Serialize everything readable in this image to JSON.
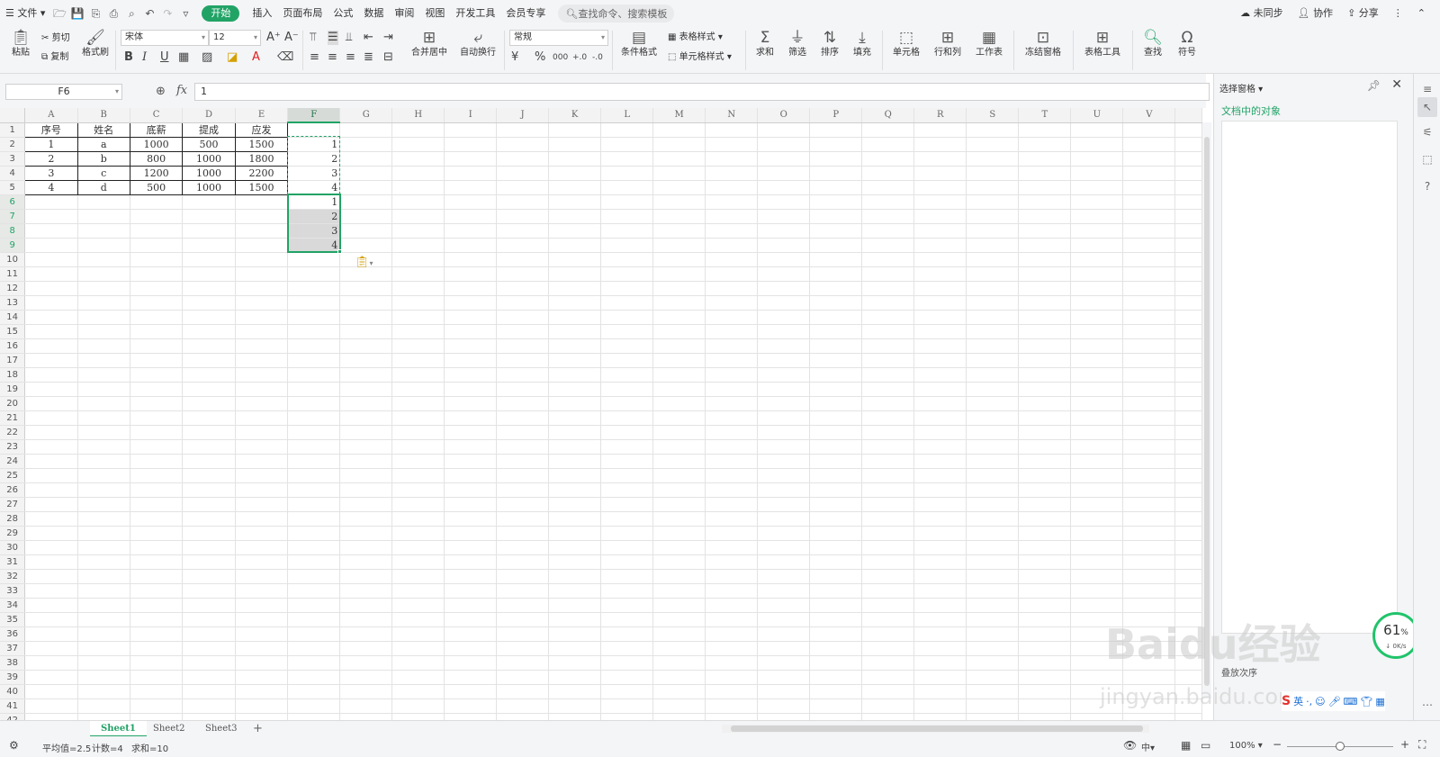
{
  "menu": {
    "file": "文件",
    "tabs": [
      "开始",
      "插入",
      "页面布局",
      "公式",
      "数据",
      "审阅",
      "视图",
      "开发工具",
      "会员专享"
    ],
    "active_tab": "开始",
    "search_placeholder": "查找命令、搜索模板",
    "sync": "未同步",
    "collab": "协作",
    "share": "分享"
  },
  "ribbon": {
    "paste": "粘贴",
    "cut": "剪切",
    "copy": "复制",
    "format_painter": "格式刷",
    "font_name": "宋体",
    "font_size": "12",
    "merge_center": "合并居中",
    "wrap_text": "自动换行",
    "number_format": "常规",
    "cond_format": "条件格式",
    "table_style": "表格样式",
    "cell_style": "单元格样式",
    "sum": "求和",
    "filter": "筛选",
    "sort": "排序",
    "fill": "填充",
    "cell": "单元格",
    "row_col": "行和列",
    "worksheet": "工作表",
    "freeze": "冻结窗格",
    "table_tools": "表格工具",
    "find": "查找",
    "symbol": "符号"
  },
  "formula_bar": {
    "cell_ref": "F6",
    "fx": "fx",
    "value": "1"
  },
  "sheet": {
    "columns": [
      "A",
      "B",
      "C",
      "D",
      "E",
      "F",
      "G",
      "H",
      "I",
      "J",
      "K",
      "L",
      "M",
      "N",
      "O",
      "P",
      "Q",
      "R",
      "S",
      "T",
      "U",
      "V"
    ],
    "selected_column": "F",
    "row_count": 42,
    "selected_rows": [
      6,
      7,
      8,
      9
    ],
    "table": {
      "header": [
        "序号",
        "姓名",
        "底薪",
        "提成",
        "应发"
      ],
      "rows": [
        [
          "1",
          "a",
          "1000",
          "500",
          "1500"
        ],
        [
          "2",
          "b",
          "800",
          "1000",
          "1800"
        ],
        [
          "3",
          "c",
          "1200",
          "1000",
          "2200"
        ],
        [
          "4",
          "d",
          "500",
          "1000",
          "1500"
        ]
      ]
    },
    "col_f": [
      "",
      "1",
      "2",
      "3",
      "4",
      "1",
      "2",
      "3",
      "4"
    ]
  },
  "side_pane": {
    "title": "选择窗格",
    "subtitle": "文档中的对象",
    "order": "叠放次序",
    "percent": "61",
    "percent_sign": "%",
    "speed": "0K/s"
  },
  "sheet_tabs": [
    "Sheet1",
    "Sheet2",
    "Sheet3"
  ],
  "active_sheet": "Sheet1",
  "status": {
    "average": "平均值=2.5",
    "count": "计数=4",
    "sum": "求和=10",
    "zoom": "100%"
  },
  "watermark": {
    "line1": "Baidu经验",
    "line2": "jingyan.baidu.com"
  },
  "ime": {
    "label": "英"
  },
  "colors": {
    "accent": "#21a366"
  }
}
